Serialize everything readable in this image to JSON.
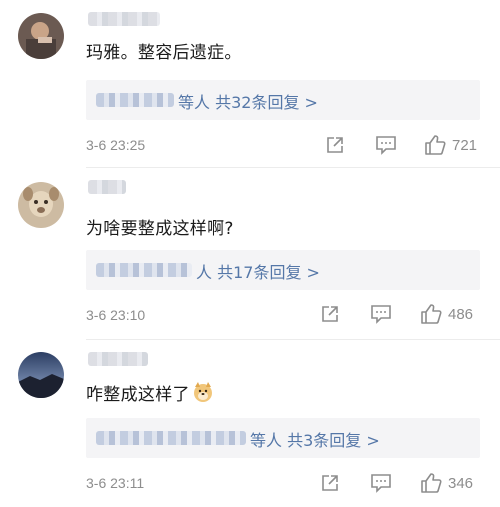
{
  "comments": [
    {
      "text": "玛雅。整容后遗症。",
      "reply_summary": "等人 共32条回复 >",
      "time": "3-6 23:25",
      "likes": "721"
    },
    {
      "text": "为啥要整成这样啊?",
      "reply_summary": "人 共17条回复 >",
      "time": "3-6 23:10",
      "likes": "486"
    },
    {
      "text": "咋整成这样了",
      "reply_summary": "等人 共3条回复 >",
      "time": "3-6 23:11",
      "likes": "346"
    }
  ]
}
